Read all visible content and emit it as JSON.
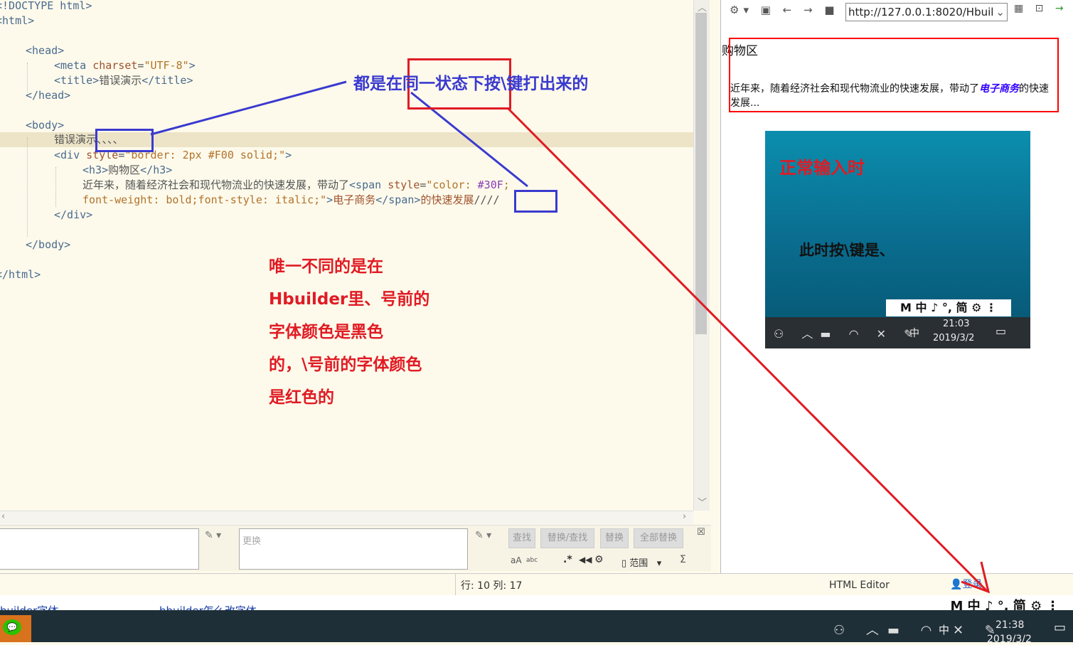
{
  "editor": {
    "lines": {
      "l1": "<!DOCTYPE html>",
      "l2_tag": "<html>",
      "l4_tag": "<head>",
      "l5_meta": "<meta ",
      "l5_attr": "charset",
      "l5_eq": "=",
      "l5_val": "\"UTF-8\"",
      "l5_end": ">",
      "l6_open": "<title>",
      "l6_text": "错误演示",
      "l6_close": "</title>",
      "l7": "</head>",
      "l9": "<body>",
      "l10": "错误演示、、、、",
      "l11_open": "<div ",
      "l11_attr": "style",
      "l11_eq": "=",
      "l11_val": "\"border: 2px #F00 solid;\"",
      "l11_end": ">",
      "l12_open": "<h3>",
      "l12_text": "购物区",
      "l12_close": "</h3>",
      "l13_text": "近年来，随着经济社会和现代物流业的快速发展，带动了",
      "l13_tag": "<span ",
      "l13_attr": "style",
      "l13_eq": "=",
      "l13_val": "\"color: ",
      "l13_color": "#30F",
      "l13_semi": ";",
      "l14_val": "font-weight: bold;font-style: italic;\"",
      "l14_end": ">",
      "l14_text": "电子商务",
      "l14_close": "</span>",
      "l14_text2": "的快速发展",
      "l14_slashes": "////",
      "l15": "</div>",
      "l17": "</body>",
      "l19": "</html>"
    }
  },
  "findbar": {
    "replace_placeholder": "更换",
    "find_btn": "查找",
    "replace_find_btn": "替换/查找",
    "replace_btn": "替换",
    "replace_all_btn": "全部替换",
    "scope_label": "范围",
    "regex_label": ".*",
    "case_label": "aA",
    "word_label": "abc",
    "sigma_label": "Σ",
    "close_label": "☒"
  },
  "status": {
    "position": "行: 10 列: 17",
    "mode": "HTML Editor",
    "login": "登录"
  },
  "browser": {
    "url": "http://127.0.0.1:8020/Hbuil",
    "h3": "购物区",
    "para_prefix": "近年来，随着经济社会和现代物流业的快速发展，带动了",
    "para_span": "电子商务",
    "para_suffix": "的快速发展...",
    "span_color": "#3300ff"
  },
  "inset": {
    "label_normal": "正常输入时",
    "label_press": "此时按\\键是、",
    "ime": "M 中 ♪ °, 简 ⚙ ⋮",
    "tray_lang": "中",
    "tray_time": "21:03",
    "tray_date": "2019/3/2"
  },
  "annotations": {
    "top_note": "都是在同一状态下按\\键打出来的",
    "note_line1": "唯一不同的是在",
    "note_line2": "Hbuilder里、号前的",
    "note_line3": "字体颜色是黑色",
    "note_line4": "的，\\号前的字体颜色",
    "note_line5": "是红色的",
    "color_blue": "#3a3ad0",
    "color_red": "#e01b24"
  },
  "taskbar": {
    "strip_left": "builder字体",
    "strip_mid": "hbuilder怎么改字体",
    "ime": "M 中 ♪ °, 简 ⚙ ⋮",
    "lang": "中",
    "time": "21:38",
    "date": "2019/3/2"
  }
}
